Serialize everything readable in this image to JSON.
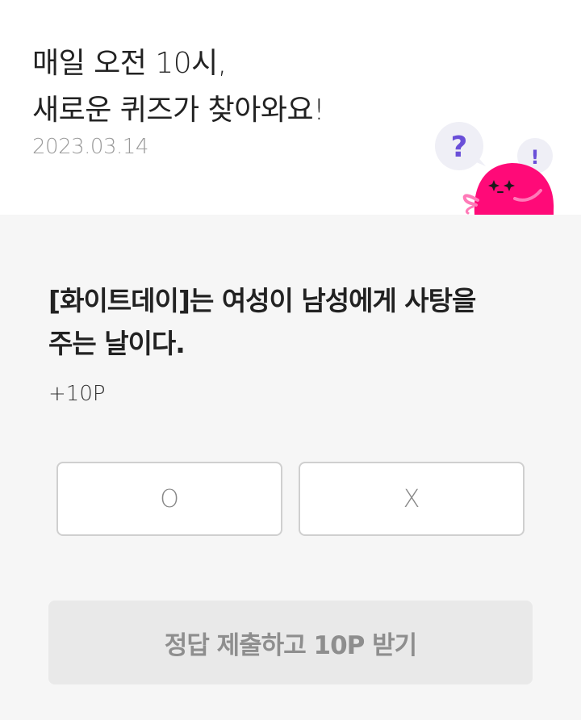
{
  "header": {
    "headline_line1": "매일 오전 10시,",
    "headline_line2": "새로운 퀴즈가 찾아와요!",
    "date": "2023.03.14"
  },
  "mascot": {
    "question_bubble": "?",
    "exclaim_bubble": "!",
    "icon": "pink-blob-character-icon",
    "colors": {
      "body": "#ff0a78",
      "bubble": "#efeff6",
      "mark": "#6a4fd8"
    }
  },
  "quiz": {
    "question_line1": "[화이트데이]는 여성이 남성에게 사탕을",
    "question_line2": "주는 날이다.",
    "points": "+10P",
    "answers": [
      {
        "label": "O"
      },
      {
        "label": "X"
      }
    ],
    "submit_label": "정답 제출하고 10P 받기"
  }
}
